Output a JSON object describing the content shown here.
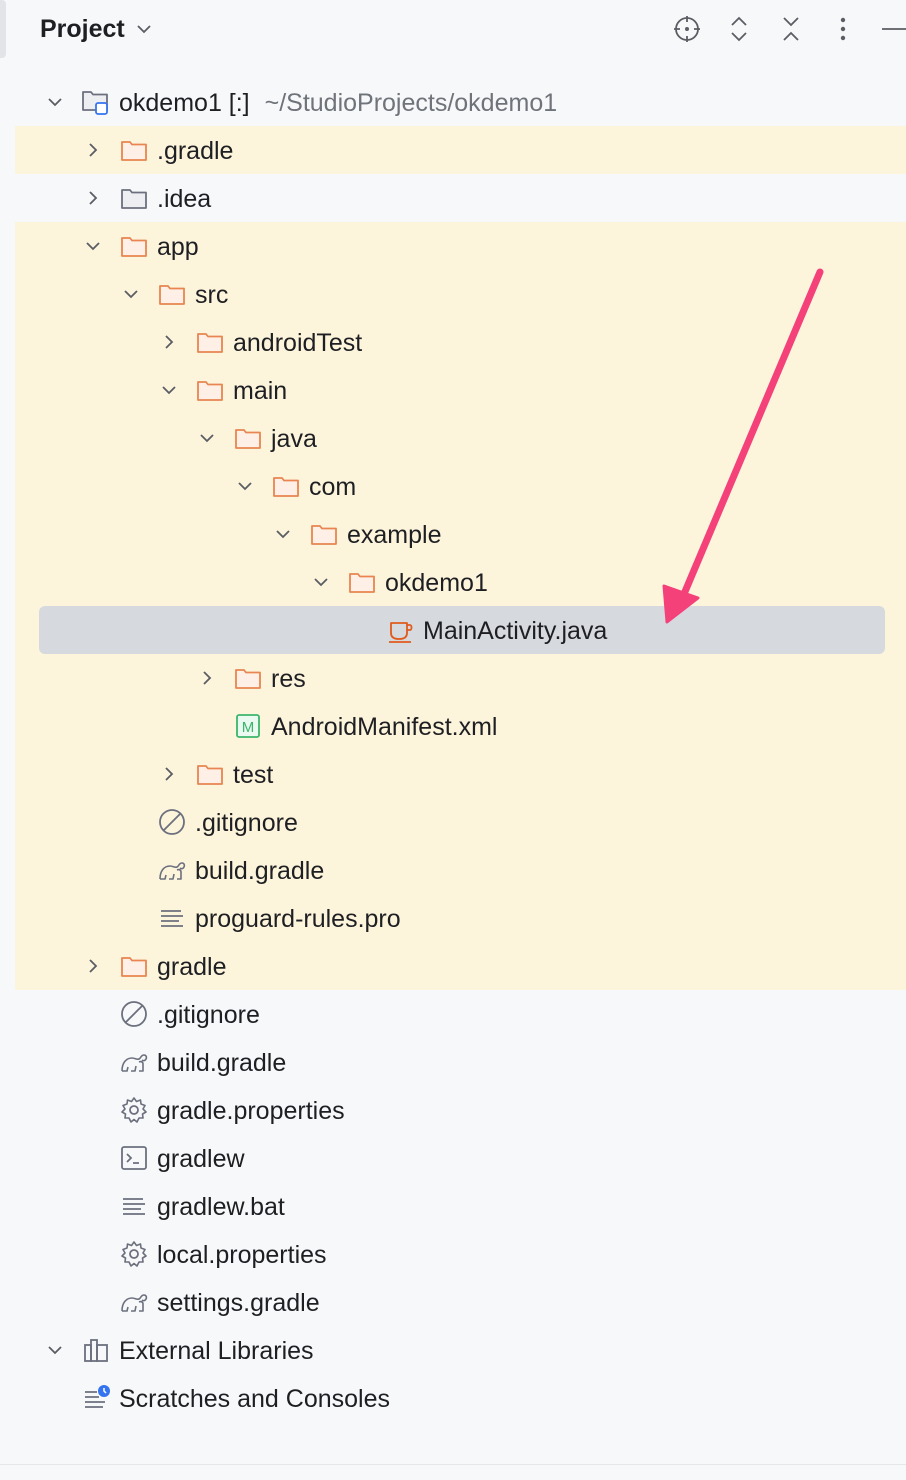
{
  "header": {
    "title": "Project",
    "buttons": [
      "locate-icon",
      "expand-all-icon",
      "collapse-all-icon",
      "more-options-icon",
      "hide-icon"
    ]
  },
  "tree": {
    "root": {
      "name": "okdemo1 [:]",
      "path": "~/StudioProjects/okdemo1"
    },
    "gradle_dir": ".gradle",
    "idea_dir": ".idea",
    "app_dir": "app",
    "src_dir": "src",
    "android_test_dir": "androidTest",
    "main_dir": "main",
    "java_dir": "java",
    "com_dir": "com",
    "example_dir": "example",
    "okdemo1_dir": "okdemo1",
    "main_activity": "MainActivity.java",
    "res_dir": "res",
    "manifest": "AndroidManifest.xml",
    "test_dir": "test",
    "app_gitignore": ".gitignore",
    "app_build_gradle": "build.gradle",
    "proguard": "proguard-rules.pro",
    "gradle_folder": "gradle",
    "root_gitignore": ".gitignore",
    "root_build_gradle": "build.gradle",
    "gradle_properties": "gradle.properties",
    "gradlew": "gradlew",
    "gradlew_bat": "gradlew.bat",
    "local_properties": "local.properties",
    "settings_gradle": "settings.gradle",
    "external_libraries": "External Libraries",
    "scratches": "Scratches and Consoles"
  },
  "colors": {
    "highlight_row": "#fdf4dc",
    "selected_row": "#d6d9de",
    "folder_orange": "#e88550",
    "annotation_arrow": "#f4417a",
    "manifest_green": "#3bb56b",
    "scratch_badge": "#3574f0"
  }
}
